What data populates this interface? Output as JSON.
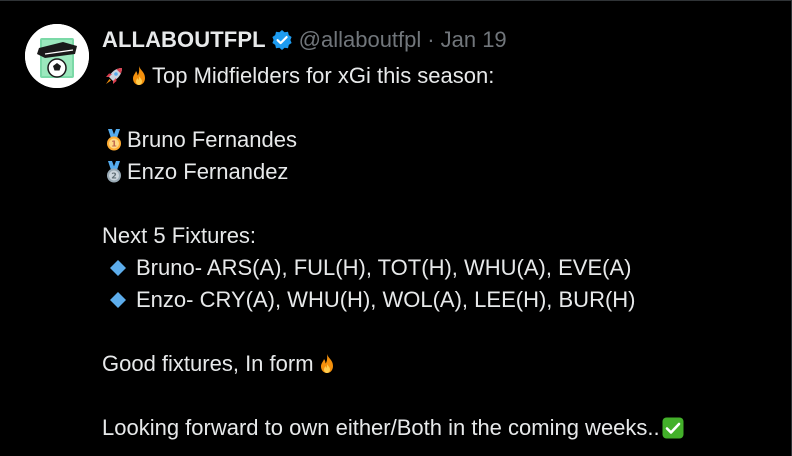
{
  "author": {
    "display_name": "ALLABOUTFPL",
    "handle": "@allaboutfpl",
    "separator": "·",
    "date": "Jan 19"
  },
  "tweet": {
    "headline": "Top Midfielders for xGi this season:",
    "players": [
      {
        "rank_icon": "gold-medal-icon",
        "name": "Bruno Fernandes"
      },
      {
        "rank_icon": "silver-medal-icon",
        "name": "Enzo Fernandez"
      }
    ],
    "fixtures_heading": "Next 5 Fixtures:",
    "fixtures": [
      "Bruno- ARS(A), FUL(H), TOT(H), WHU(A), EVE(A)",
      "Enzo- CRY(A), WHU(H), WOL(A), LEE(H), BUR(H)"
    ],
    "form_line": "Good fixtures, In form",
    "closing_line": "Looking forward to own either/Both in the coming weeks.."
  },
  "icons": {
    "verified": "verified-badge-icon",
    "rocket": "rocket-icon",
    "fire": "fire-icon",
    "diamond": "blue-diamond-icon",
    "check": "check-mark-button-icon"
  },
  "colors": {
    "background": "#000000",
    "text": "#e7e9ea",
    "muted": "#71767b",
    "verified": "#1d9bf0",
    "check_green": "#43b02a"
  }
}
